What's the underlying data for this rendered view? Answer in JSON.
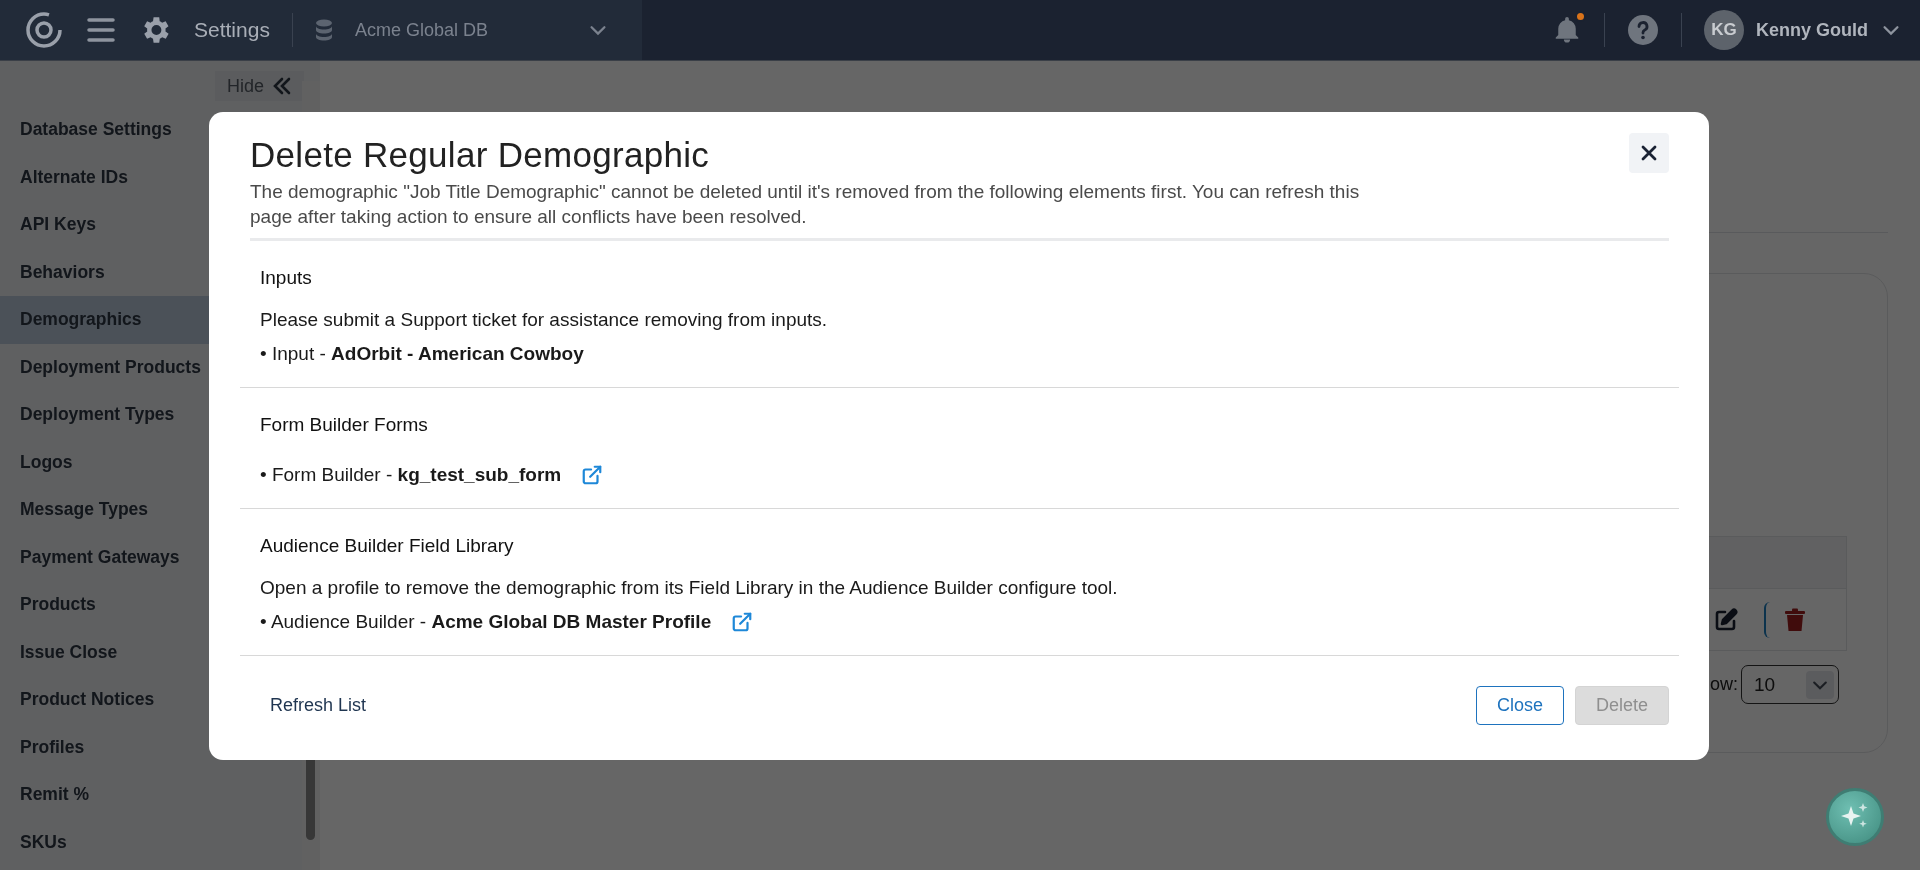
{
  "topbar": {
    "title": "Settings",
    "database": "Acme Global DB",
    "has_alert": true,
    "user_initials": "KG",
    "user_name": "Kenny Gould"
  },
  "sidebar": {
    "hide_label": "Hide",
    "items": [
      {
        "label": "Database Settings",
        "selected": false
      },
      {
        "label": "Alternate IDs",
        "selected": false
      },
      {
        "label": "API Keys",
        "selected": false
      },
      {
        "label": "Behaviors",
        "selected": false
      },
      {
        "label": "Demographics",
        "selected": true
      },
      {
        "label": "Deployment Products",
        "selected": false
      },
      {
        "label": "Deployment Types",
        "selected": false
      },
      {
        "label": "Logos",
        "selected": false
      },
      {
        "label": "Message Types",
        "selected": false
      },
      {
        "label": "Payment Gateways",
        "selected": false
      },
      {
        "label": "Products",
        "selected": false
      },
      {
        "label": "Issue Close",
        "selected": false
      },
      {
        "label": "Product Notices",
        "selected": false
      },
      {
        "label": "Profiles",
        "selected": false
      },
      {
        "label": "Remit %",
        "selected": false
      },
      {
        "label": "SKUs",
        "selected": false
      }
    ]
  },
  "background": {
    "rows_label": "ow:",
    "rows_value": "10"
  },
  "modal": {
    "title": "Delete Regular Demographic",
    "description": "The demographic \"Job Title Demographic\" cannot be deleted until it's removed from the following elements first. You can refresh this page after taking action to ensure all conflicts have been resolved.",
    "sections": [
      {
        "heading": "Inputs",
        "note": "Please submit a Support ticket for assistance removing from inputs.",
        "items": [
          {
            "text": "• Input - **AdOrbit - American Cowboy**",
            "external_link": false
          }
        ]
      },
      {
        "heading": "Form Builder Forms",
        "items": [
          {
            "text": "• Form Builder - **kg_test_sub_form**",
            "external_link": true
          }
        ]
      },
      {
        "heading": "Audience Builder Field Library",
        "note": "Open a profile to remove the demographic from its Field Library in the Audience Builder configure tool.",
        "items": [
          {
            "text": "• Audience Builder - **Acme Global DB Master Profile**",
            "external_link": true
          }
        ]
      }
    ],
    "refresh_label": "Refresh List",
    "close_label": "Close",
    "delete": {
      "label": "Delete",
      "disabled": true
    }
  }
}
